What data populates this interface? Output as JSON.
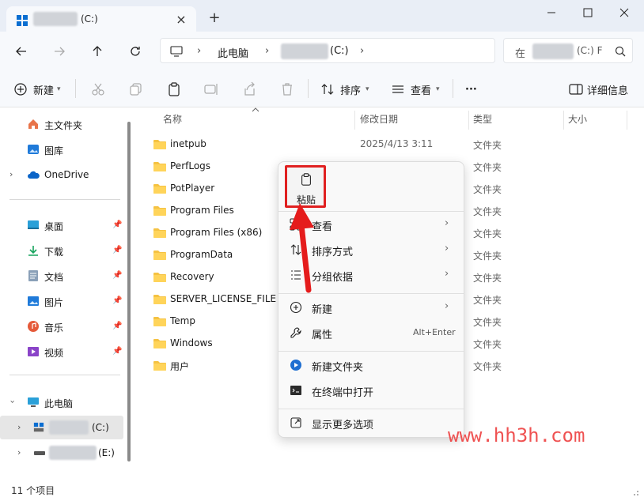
{
  "tab": {
    "title_suffix": "(C:)",
    "close": "×",
    "new": "+"
  },
  "window_controls": {
    "minimize": "—",
    "maximize": "☐",
    "close": "✕"
  },
  "address": {
    "root": "此电脑",
    "drive": "(C:)"
  },
  "search": {
    "prefix": "在",
    "drive": "(C:) F"
  },
  "toolbar": {
    "new_label": "新建",
    "sort_label": "排序",
    "view_label": "查看",
    "more_label": "···",
    "details_label": "详细信息"
  },
  "sidebar": {
    "home": "主文件夹",
    "gallery": "图库",
    "onedrive": "OneDrive",
    "quick": [
      {
        "label": "桌面"
      },
      {
        "label": "下载"
      },
      {
        "label": "文档"
      },
      {
        "label": "图片"
      },
      {
        "label": "音乐"
      },
      {
        "label": "视频"
      }
    ],
    "this_pc": "此电脑",
    "drive_c": "(C:)",
    "drive_e": "(E:)"
  },
  "columns": {
    "name": "名称",
    "date": "修改日期",
    "type": "类型",
    "size": "大小"
  },
  "files": [
    {
      "name": "inetpub",
      "date": "2025/4/13 3:11",
      "type": "文件夹"
    },
    {
      "name": "PerfLogs",
      "date": "",
      "type": "文件夹"
    },
    {
      "name": "PotPlayer",
      "date": "",
      "type": "文件夹"
    },
    {
      "name": "Program Files",
      "date": "",
      "type": "文件夹"
    },
    {
      "name": "Program Files (x86)",
      "date": "",
      "type": "文件夹"
    },
    {
      "name": "ProgramData",
      "date": "",
      "type": "文件夹"
    },
    {
      "name": "Recovery",
      "date": "",
      "type": "文件夹"
    },
    {
      "name": "SERVER_LICENSE_FILE",
      "date": "",
      "type": "文件夹"
    },
    {
      "name": "Temp",
      "date": "",
      "type": "文件夹"
    },
    {
      "name": "Windows",
      "date": "",
      "type": "文件夹"
    },
    {
      "name": "用户",
      "date": "",
      "type": "文件夹"
    }
  ],
  "status": {
    "count": "11 个项目"
  },
  "context_menu": {
    "paste": "粘贴",
    "view": "查看",
    "sort_by": "排序方式",
    "group_by": "分组依据",
    "new": "新建",
    "properties": "属性",
    "properties_shortcut": "Alt+Enter",
    "new_folder": "新建文件夹",
    "open_terminal": "在终端中打开",
    "show_more": "显示更多选项"
  },
  "watermark": "www.hh3h.com",
  "colors": {
    "accent": "#0067c0",
    "highlight": "#e02020",
    "folder": "#f5c242"
  }
}
